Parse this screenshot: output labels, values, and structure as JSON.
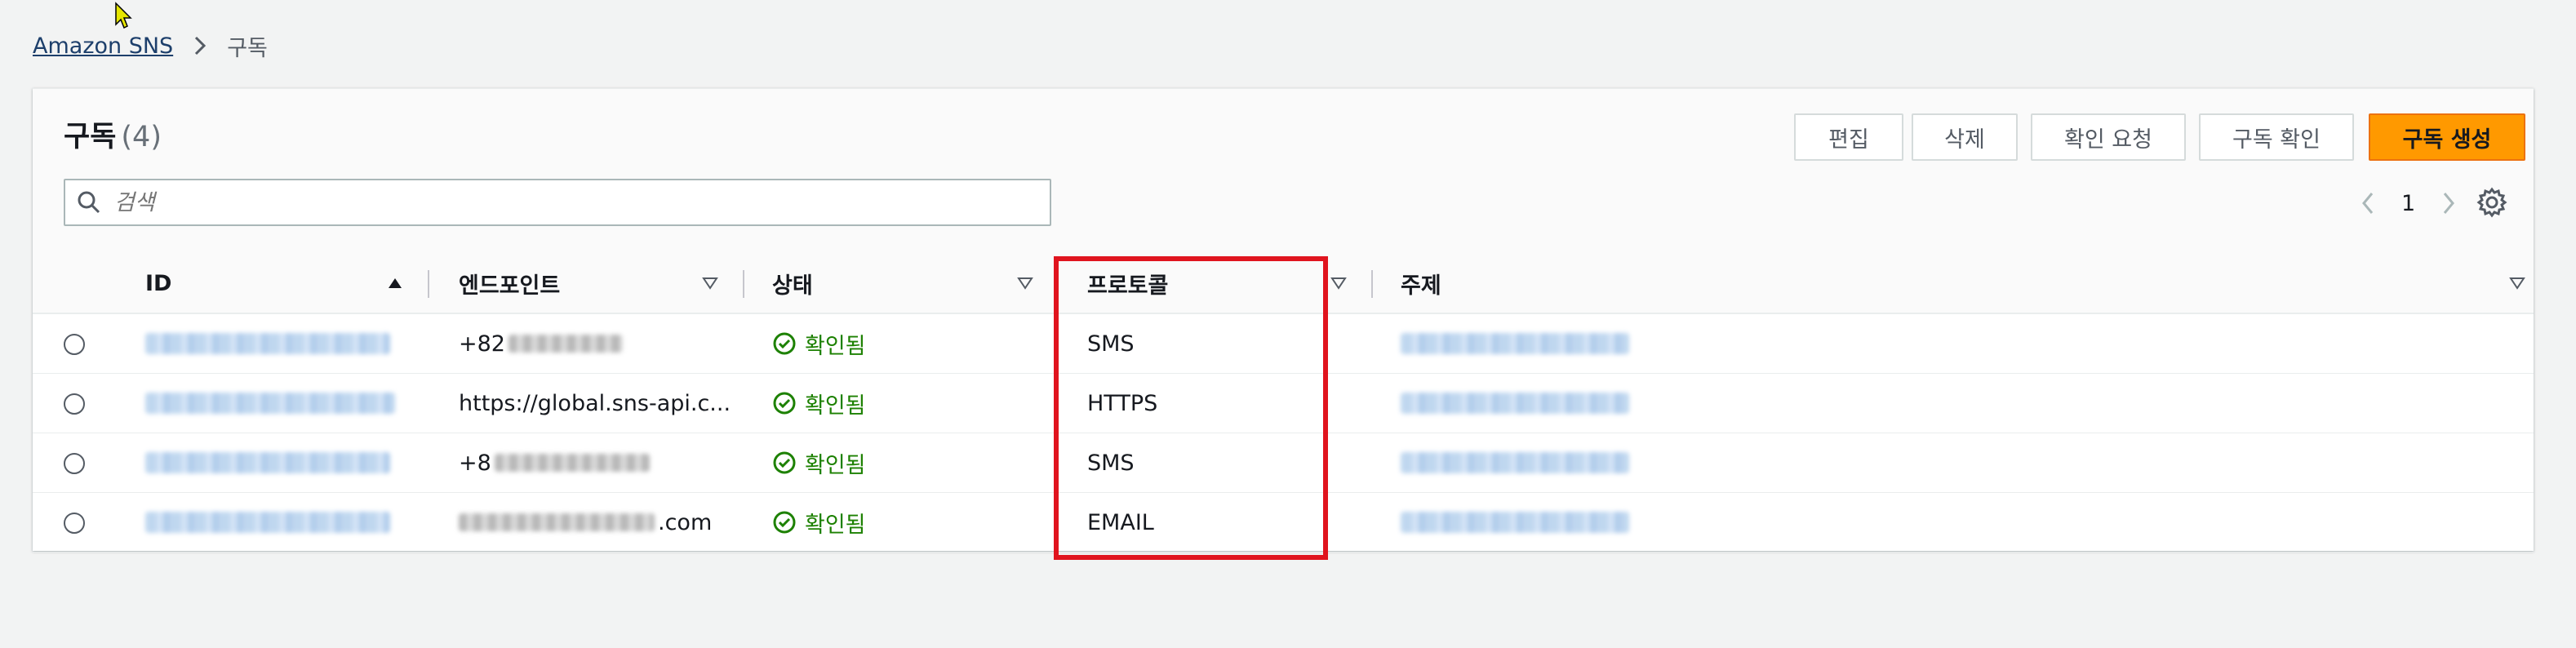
{
  "breadcrumb": {
    "root": "Amazon SNS",
    "current": "구독"
  },
  "panel": {
    "title": "구독",
    "count": "(4)"
  },
  "actions": {
    "edit": "편집",
    "delete": "삭제",
    "request_confirmation": "확인 요청",
    "confirm_subscription": "구독 확인",
    "create_subscription": "구독 생성"
  },
  "search": {
    "placeholder": "검색"
  },
  "pagination": {
    "current_page": "1"
  },
  "columns": {
    "id": "ID",
    "endpoint": "엔드포인트",
    "status": "상태",
    "protocol": "프로토콜",
    "topic": "주제"
  },
  "rows": [
    {
      "endpoint": "+82",
      "status": "확인됨",
      "protocol": "SMS"
    },
    {
      "endpoint": "https://global.sns-api.c...",
      "status": "확인됨",
      "protocol": "HTTPS"
    },
    {
      "endpoint": "+8",
      "status": "확인됨",
      "protocol": "SMS"
    },
    {
      "endpoint": ".com",
      "status": "확인됨",
      "protocol": "EMAIL"
    }
  ],
  "colors": {
    "primary": "#ff9900",
    "status_ok": "#1d8102",
    "highlight": "#e0141e"
  },
  "icons": [
    "cursor-icon",
    "chevron-right-icon",
    "search-icon",
    "chevron-left-icon",
    "settings-icon",
    "sort-ascending-icon",
    "sort-icon",
    "check-circle-icon"
  ]
}
